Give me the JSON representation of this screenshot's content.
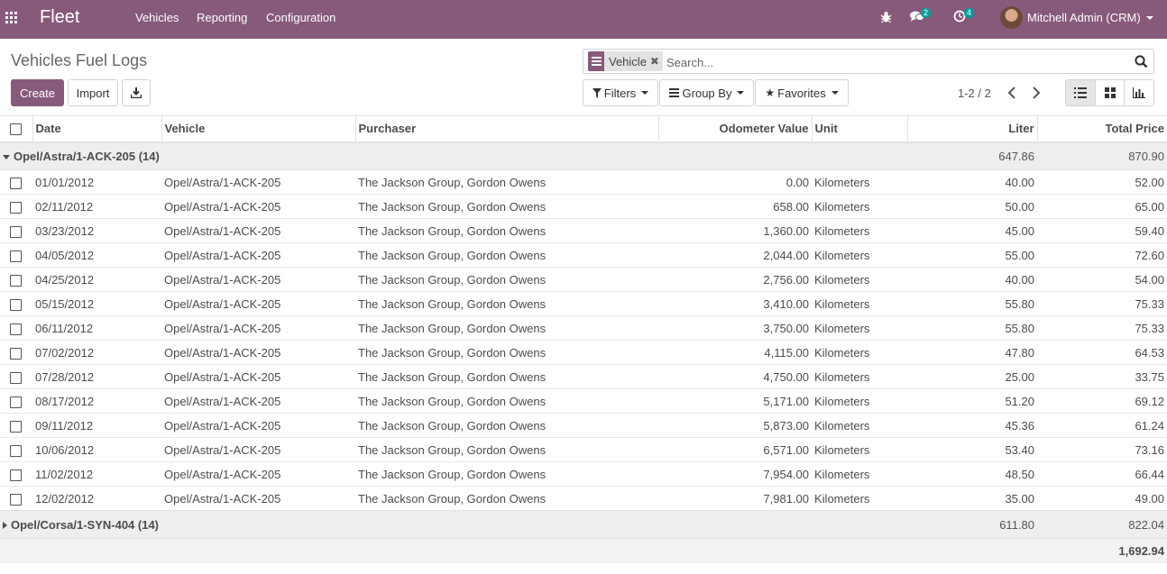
{
  "navbar": {
    "brand": "Fleet",
    "menu": [
      "Vehicles",
      "Reporting",
      "Configuration"
    ],
    "messages_count": "2",
    "activities_count": "4",
    "user_name": "Mitchell Admin (CRM)",
    "color": "#875a7b"
  },
  "control_panel": {
    "title": "Vehicles Fuel Logs",
    "create_label": "Create",
    "import_label": "Import",
    "search": {
      "facet_value": "Vehicle",
      "placeholder": "Search..."
    },
    "filters_label": "Filters",
    "groupby_label": "Group By",
    "favorites_label": "Favorites",
    "pager": "1-2 / 2"
  },
  "table": {
    "columns": [
      "Date",
      "Vehicle",
      "Purchaser",
      "Odometer Value",
      "Unit",
      "Liter",
      "Total Price"
    ],
    "groups": [
      {
        "label": "Opel/Astra/1-ACK-205 (14)",
        "liter": "647.86",
        "total_price": "870.90",
        "expanded": true,
        "rows": [
          {
            "date": "01/01/2012",
            "vehicle": "Opel/Astra/1-ACK-205",
            "purchaser": "The Jackson Group, Gordon Owens",
            "odometer": "0.00",
            "unit": "Kilometers",
            "liter": "40.00",
            "total": "52.00"
          },
          {
            "date": "02/11/2012",
            "vehicle": "Opel/Astra/1-ACK-205",
            "purchaser": "The Jackson Group, Gordon Owens",
            "odometer": "658.00",
            "unit": "Kilometers",
            "liter": "50.00",
            "total": "65.00"
          },
          {
            "date": "03/23/2012",
            "vehicle": "Opel/Astra/1-ACK-205",
            "purchaser": "The Jackson Group, Gordon Owens",
            "odometer": "1,360.00",
            "unit": "Kilometers",
            "liter": "45.00",
            "total": "59.40"
          },
          {
            "date": "04/05/2012",
            "vehicle": "Opel/Astra/1-ACK-205",
            "purchaser": "The Jackson Group, Gordon Owens",
            "odometer": "2,044.00",
            "unit": "Kilometers",
            "liter": "55.00",
            "total": "72.60"
          },
          {
            "date": "04/25/2012",
            "vehicle": "Opel/Astra/1-ACK-205",
            "purchaser": "The Jackson Group, Gordon Owens",
            "odometer": "2,756.00",
            "unit": "Kilometers",
            "liter": "40.00",
            "total": "54.00"
          },
          {
            "date": "05/15/2012",
            "vehicle": "Opel/Astra/1-ACK-205",
            "purchaser": "The Jackson Group, Gordon Owens",
            "odometer": "3,410.00",
            "unit": "Kilometers",
            "liter": "55.80",
            "total": "75.33"
          },
          {
            "date": "06/11/2012",
            "vehicle": "Opel/Astra/1-ACK-205",
            "purchaser": "The Jackson Group, Gordon Owens",
            "odometer": "3,750.00",
            "unit": "Kilometers",
            "liter": "55.80",
            "total": "75.33"
          },
          {
            "date": "07/02/2012",
            "vehicle": "Opel/Astra/1-ACK-205",
            "purchaser": "The Jackson Group, Gordon Owens",
            "odometer": "4,115.00",
            "unit": "Kilometers",
            "liter": "47.80",
            "total": "64.53"
          },
          {
            "date": "07/28/2012",
            "vehicle": "Opel/Astra/1-ACK-205",
            "purchaser": "The Jackson Group, Gordon Owens",
            "odometer": "4,750.00",
            "unit": "Kilometers",
            "liter": "25.00",
            "total": "33.75"
          },
          {
            "date": "08/17/2012",
            "vehicle": "Opel/Astra/1-ACK-205",
            "purchaser": "The Jackson Group, Gordon Owens",
            "odometer": "5,171.00",
            "unit": "Kilometers",
            "liter": "51.20",
            "total": "69.12"
          },
          {
            "date": "09/11/2012",
            "vehicle": "Opel/Astra/1-ACK-205",
            "purchaser": "The Jackson Group, Gordon Owens",
            "odometer": "5,873.00",
            "unit": "Kilometers",
            "liter": "45.36",
            "total": "61.24"
          },
          {
            "date": "10/06/2012",
            "vehicle": "Opel/Astra/1-ACK-205",
            "purchaser": "The Jackson Group, Gordon Owens",
            "odometer": "6,571.00",
            "unit": "Kilometers",
            "liter": "53.40",
            "total": "73.16"
          },
          {
            "date": "11/02/2012",
            "vehicle": "Opel/Astra/1-ACK-205",
            "purchaser": "The Jackson Group, Gordon Owens",
            "odometer": "7,954.00",
            "unit": "Kilometers",
            "liter": "48.50",
            "total": "66.44"
          },
          {
            "date": "12/02/2012",
            "vehicle": "Opel/Astra/1-ACK-205",
            "purchaser": "The Jackson Group, Gordon Owens",
            "odometer": "7,981.00",
            "unit": "Kilometers",
            "liter": "35.00",
            "total": "49.00"
          }
        ]
      },
      {
        "label": "Opel/Corsa/1-SYN-404 (14)",
        "liter": "611.80",
        "total_price": "822.04",
        "expanded": false,
        "rows": []
      }
    ],
    "grand_total": "1,692.94"
  }
}
